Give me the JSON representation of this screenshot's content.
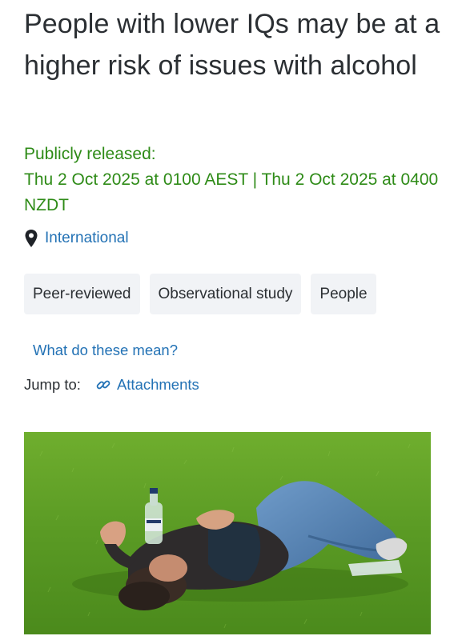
{
  "article": {
    "headline": "People with lower IQs may be at a higher risk of issues with alcohol",
    "release_label": "Publicly released:",
    "release_dates": "Thu 2 Oct 2025 at 0100 AEST | Thu 2 Oct 2025 at 0400 NZDT",
    "location": "International",
    "location_icon": "map-pin-icon",
    "tags": [
      "Peer-reviewed",
      "Observational study",
      "People"
    ],
    "tags_help_link": "What do these mean?",
    "jump_label": "Jump to:",
    "jump_link": "Attachments",
    "jump_link_icon": "link-icon"
  },
  "colors": {
    "release_green": "#2e8b17",
    "link_blue": "#2372b5",
    "tag_bg": "#f1f3f6",
    "text": "#2b2f33"
  }
}
